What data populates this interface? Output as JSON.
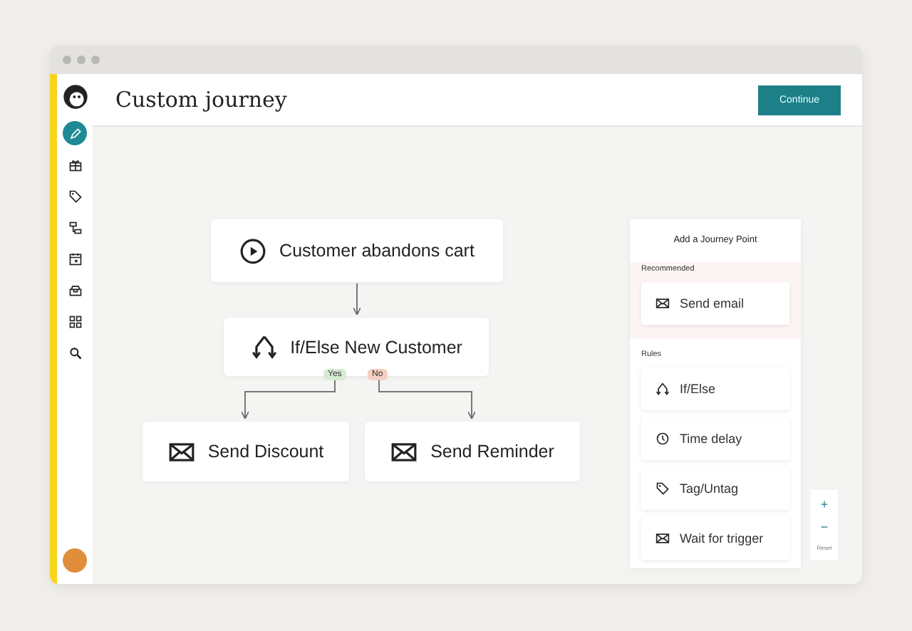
{
  "window": {
    "title": "Custom journey"
  },
  "header": {
    "action": "Continue"
  },
  "sidebar": {
    "items": [
      {
        "kind": "edit",
        "selected": true
      },
      {
        "kind": "gift",
        "selected": false
      },
      {
        "kind": "tag",
        "selected": false
      },
      {
        "kind": "flow",
        "selected": false
      },
      {
        "kind": "calendar",
        "selected": false
      },
      {
        "kind": "box",
        "selected": false
      },
      {
        "kind": "grid",
        "selected": false
      },
      {
        "kind": "search",
        "selected": false
      }
    ]
  },
  "journey": {
    "nodes": [
      {
        "kind": "trigger",
        "label": "Customer abandons cart"
      },
      {
        "kind": "condition",
        "label": "If/Else New Customer"
      },
      {
        "kind": "email",
        "label": "Send Discount"
      },
      {
        "kind": "email",
        "label": "Send Reminder"
      }
    ],
    "branches": [
      {
        "label": "Yes",
        "color": "#d6ecd2"
      },
      {
        "label": "No",
        "color": "#f7cfc2"
      }
    ]
  },
  "panel": {
    "title": "Add a Journey Point",
    "sections": [
      {
        "heading": "Recommended",
        "items": [
          {
            "kind": "email",
            "label": "Send email"
          }
        ]
      },
      {
        "heading": "Rules",
        "items": [
          {
            "kind": "condition",
            "label": "If/Else"
          },
          {
            "kind": "clock",
            "label": "Time delay"
          },
          {
            "kind": "tag",
            "label": "Tag/Untag"
          },
          {
            "kind": "email",
            "label": "Wait for trigger"
          }
        ]
      }
    ]
  },
  "zoom": {
    "plus": "+",
    "minus": "−",
    "reset": "Reset"
  }
}
